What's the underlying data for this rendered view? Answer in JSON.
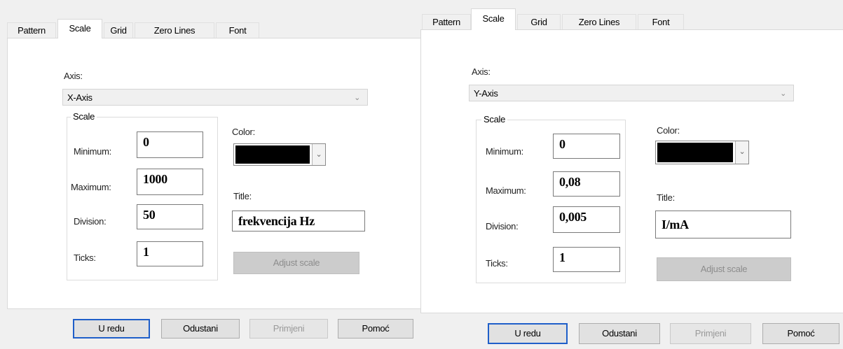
{
  "left": {
    "tabs": [
      "Pattern",
      "Scale",
      "Grid",
      "Zero Lines",
      "Font"
    ],
    "axis_label": "Axis:",
    "axis_value": "X-Axis",
    "scale_group": "Scale",
    "minimum_label": "Minimum:",
    "minimum_value": "0",
    "maximum_label": "Maximum:",
    "maximum_value": "1000",
    "division_label": "Division:",
    "division_value": "50",
    "ticks_label": "Ticks:",
    "ticks_value": "1",
    "color_label": "Color:",
    "color_value": "#000000",
    "title_label": "Title:",
    "title_value": "frekvencija Hz",
    "adjust_label": "Adjust scale",
    "buttons": [
      "U redu",
      "Odustani",
      "Primjeni",
      "Pomoć"
    ]
  },
  "right": {
    "tabs": [
      "Pattern",
      "Scale",
      "Grid",
      "Zero Lines",
      "Font"
    ],
    "axis_label": "Axis:",
    "axis_value": "Y-Axis",
    "scale_group": "Scale",
    "minimum_label": "Minimum:",
    "minimum_value": "0",
    "maximum_label": "Maximum:",
    "maximum_value": "0,08",
    "division_label": "Division:",
    "division_value": "0,005",
    "ticks_label": "Ticks:",
    "ticks_value": "1",
    "color_label": "Color:",
    "color_value": "#000000",
    "title_label": "Title:",
    "title_value": "I/mA",
    "adjust_label": "Adjust scale",
    "buttons": [
      "U redu",
      "Odustani",
      "Primjeni",
      "Pomoć"
    ]
  },
  "icons": {
    "dropdown": "chevron-down-icon"
  }
}
